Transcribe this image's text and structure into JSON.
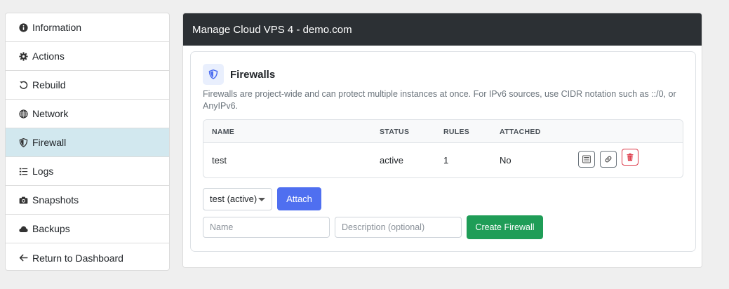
{
  "sidebar": {
    "items": [
      {
        "label": "Information",
        "icon": "info-icon"
      },
      {
        "label": "Actions",
        "icon": "gear-icon"
      },
      {
        "label": "Rebuild",
        "icon": "undo-icon"
      },
      {
        "label": "Network",
        "icon": "globe-icon"
      },
      {
        "label": "Firewall",
        "icon": "shield-icon",
        "active": true
      },
      {
        "label": "Logs",
        "icon": "list-icon"
      },
      {
        "label": "Snapshots",
        "icon": "camera-icon"
      },
      {
        "label": "Backups",
        "icon": "cloud-icon"
      },
      {
        "label": "Return to Dashboard",
        "icon": "arrow-left-icon"
      }
    ]
  },
  "main": {
    "title": "Manage Cloud VPS 4 - demo.com",
    "firewalls": {
      "heading": "Firewalls",
      "description": "Firewalls are project-wide and can protect multiple instances at once. For IPv6 sources, use CIDR notation such as ::/0, or AnyIPv6.",
      "columns": [
        "NAME",
        "STATUS",
        "RULES",
        "ATTACHED"
      ],
      "rows": [
        {
          "name": "test",
          "status": "active",
          "rules": "1",
          "attached": "No"
        }
      ],
      "select_value": "test (active)",
      "attach_label": "Attach",
      "name_placeholder": "Name",
      "desc_placeholder": "Description (optional)",
      "create_label": "Create Firewall"
    }
  },
  "colors": {
    "header_bg": "#2c3034",
    "active_item": "#d2e8ef",
    "attach_btn": "#4f6ff0",
    "create_btn": "#1f9d57",
    "danger": "#dc3545",
    "shield_accent": "#4f6ff0"
  }
}
